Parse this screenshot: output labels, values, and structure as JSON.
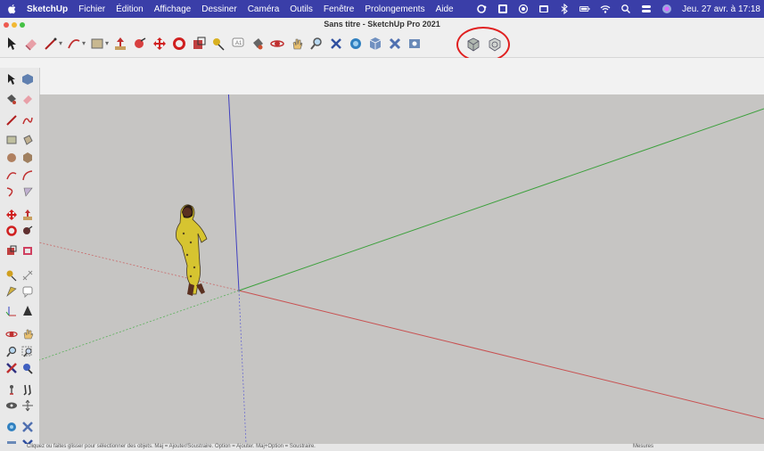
{
  "menubar": {
    "items": [
      "SketchUp",
      "Fichier",
      "Édition",
      "Affichage",
      "Dessiner",
      "Caméra",
      "Outils",
      "Fenêtre",
      "Prolongements",
      "Aide"
    ],
    "clock": "Jeu. 27 avr. à 17:18"
  },
  "window": {
    "title": "Sans titre - SketchUp Pro 2021"
  },
  "toolbar": {
    "icons": [
      "select-icon",
      "eraser-icon",
      "line-icon",
      "arc-icon",
      "rectangle-icon",
      "push-pull-icon",
      "follow-me-icon",
      "move-icon",
      "rotate-icon",
      "scale-icon",
      "tape-measure-icon",
      "text-icon",
      "paint-bucket-icon",
      "orbit-icon",
      "pan-icon",
      "zoom-icon",
      "zoom-extents-icon",
      "3d-warehouse-icon",
      "extension-warehouse-icon",
      "extension-manager-icon",
      "layout-icon",
      "outer-shell-icon",
      "solid-tools-icon"
    ],
    "highlight_color": "#e02020"
  },
  "statusbar": {
    "text": "Cliquez ou faites glisser pour sélectionner des objets. Maj = Ajouter/Soustraire. Option = Ajouter. Maj+Option = Soustraire.",
    "measurements_label": "Mesures"
  },
  "colors": {
    "menubar": "#3a3ea8",
    "viewport": "#c6c5c3",
    "axis_red": "#c85050",
    "axis_green": "#3ca03c",
    "axis_blue": "#4040c0"
  }
}
